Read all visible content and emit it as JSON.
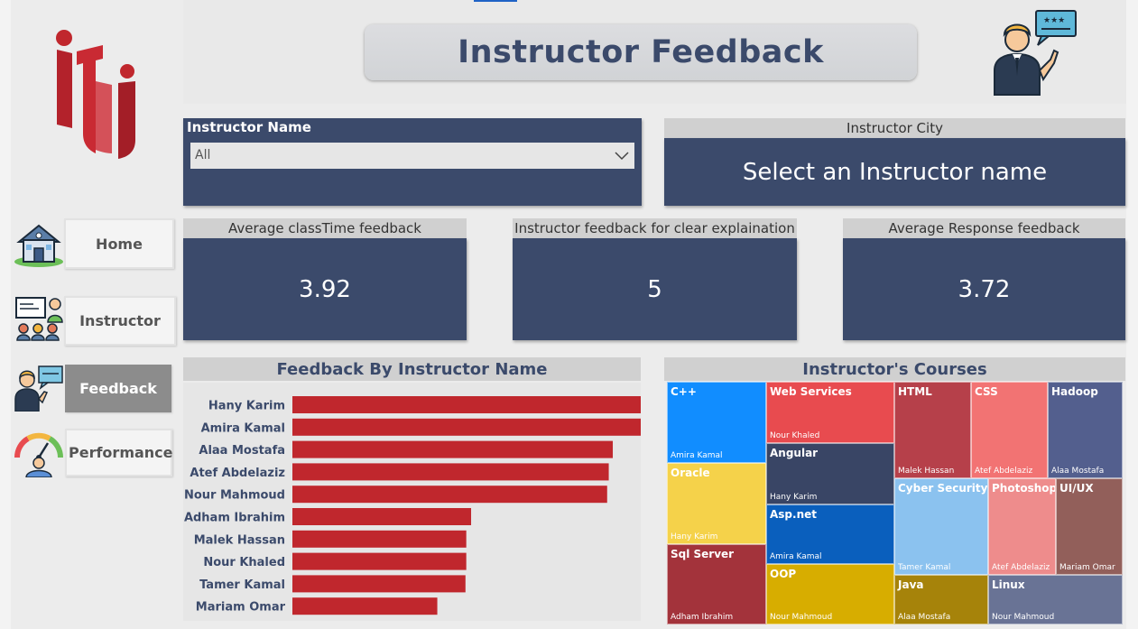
{
  "header": {
    "title": "Instructor Feedback"
  },
  "nav": {
    "items": [
      {
        "label": "Home",
        "icon": "house-icon",
        "active": false
      },
      {
        "label": "Instructor",
        "icon": "classroom-icon",
        "active": false
      },
      {
        "label": "Feedback",
        "icon": "instructor-feedback-icon",
        "active": true
      },
      {
        "label": "Performance",
        "icon": "gauge-icon",
        "active": false
      }
    ]
  },
  "logo": {
    "name": "iti-logo-icon"
  },
  "filters": {
    "instructor_name": {
      "label": "Instructor Name",
      "value": "All"
    },
    "instructor_city": {
      "label": "Instructor City",
      "value": "Select an Instructor name"
    }
  },
  "kpis": [
    {
      "label": "Average classTime feedback",
      "value": "3.92"
    },
    {
      "label": "Instructor feedback for clear explaination",
      "value": "5"
    },
    {
      "label": "Average Response feedback",
      "value": "3.72"
    }
  ],
  "bar_chart": {
    "title": "Feedback By Instructor Name",
    "color": "#c0272d",
    "rows": [
      {
        "name": "Hany Karim",
        "value": 4.46
      },
      {
        "name": "Amira Kamal",
        "value": 4.38
      },
      {
        "name": "Alaa Mostafa",
        "value": 3.98
      },
      {
        "name": "Atef Abdelaziz",
        "value": 3.93
      },
      {
        "name": "Nour Mahmoud",
        "value": 3.91
      },
      {
        "name": "Adham Ibrahim",
        "value": 2.22
      },
      {
        "name": "Malek Hassan",
        "value": 2.16
      },
      {
        "name": "Nour Khaled",
        "value": 2.16
      },
      {
        "name": "Tamer Kamal",
        "value": 2.15
      },
      {
        "name": "Mariam Omar",
        "value": 1.8
      }
    ]
  },
  "treemap": {
    "title": "Instructor's Courses",
    "tiles": [
      {
        "course": "C++",
        "instructor": "Amira Kamal",
        "color": "#118dff"
      },
      {
        "course": "Web Services",
        "instructor": "Nour Khaled",
        "color": "#e84b4f"
      },
      {
        "course": "HTML",
        "instructor": "Malek Hassan",
        "color": "#b6404a"
      },
      {
        "course": "CSS",
        "instructor": "Atef Abdelaziz",
        "color": "#f27373"
      },
      {
        "course": "Hadoop",
        "instructor": "Alaa Mostafa",
        "color": "#535f8e"
      },
      {
        "course": "Oracle",
        "instructor": "Hany Karim",
        "color": "#f5d24a"
      },
      {
        "course": "Angular",
        "instructor": "Hany Karim",
        "color": "#394565"
      },
      {
        "course": "Cyber Security",
        "instructor": "Tamer Kamal",
        "color": "#8bc2ef"
      },
      {
        "course": "Photoshop",
        "instructor": "Atef Abdelaziz",
        "color": "#ee8c8c"
      },
      {
        "course": "UI/UX",
        "instructor": "Mariam Omar",
        "color": "#925f5a"
      },
      {
        "course": "Asp.net",
        "instructor": "Amira Kamal",
        "color": "#0a5fbd"
      },
      {
        "course": "Sql Server",
        "instructor": "Adham Ibrahim",
        "color": "#a3333b"
      },
      {
        "course": "OOP",
        "instructor": "Nour Mahmoud",
        "color": "#d7ad00"
      },
      {
        "course": "Java",
        "instructor": "Alaa Mostafa",
        "color": "#a6830a"
      },
      {
        "course": "Linux",
        "instructor": "Nour Mahmoud",
        "color": "#697395"
      }
    ]
  }
}
